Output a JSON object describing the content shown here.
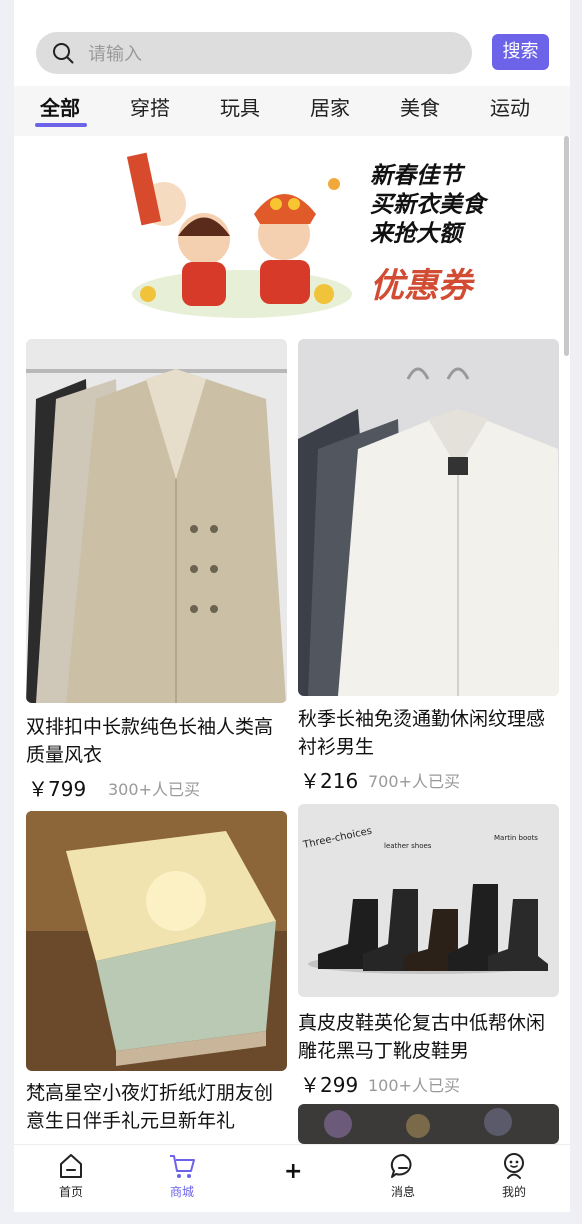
{
  "search": {
    "placeholder": "请输入",
    "button_label": "搜索"
  },
  "tabs": [
    {
      "label": "全部",
      "active": true
    },
    {
      "label": "穿搭",
      "active": false
    },
    {
      "label": "玩具",
      "active": false
    },
    {
      "label": "居家",
      "active": false
    },
    {
      "label": "美食",
      "active": false
    },
    {
      "label": "运动",
      "active": false
    }
  ],
  "banner": {
    "lines": [
      "新春佳节",
      "买新衣美食",
      "来抢大额"
    ],
    "coupon": "优惠券"
  },
  "products": [
    {
      "title": "双排扣中长款纯色长袖人类高质量风衣",
      "price": "￥799",
      "sold": "300+人已买"
    },
    {
      "title": "秋季长袖免烫通勤休闲纹理感衬衫男生",
      "price": "￥216",
      "sold": "700+人已买"
    },
    {
      "title": "梵高星空小夜灯折纸灯朋友创意生日伴手礼元旦新年礼",
      "price": "",
      "sold": ""
    },
    {
      "title": "真皮皮鞋英伦复古中低帮休闲雕花黑马丁靴皮鞋男",
      "price": "￥299",
      "sold": "100+人已买"
    }
  ],
  "boots_labels": {
    "a": "Three-choices",
    "b": "leather shoes",
    "c": "Martin boots"
  },
  "nav": [
    {
      "label": "首页",
      "icon": "home-icon"
    },
    {
      "label": "商城",
      "icon": "cart-icon",
      "active": true
    },
    {
      "label": "+",
      "icon": "plus-icon"
    },
    {
      "label": "消息",
      "icon": "message-icon"
    },
    {
      "label": "我的",
      "icon": "profile-icon"
    }
  ],
  "colors": {
    "accent": "#6c63e8",
    "coupon": "#d24b33"
  }
}
